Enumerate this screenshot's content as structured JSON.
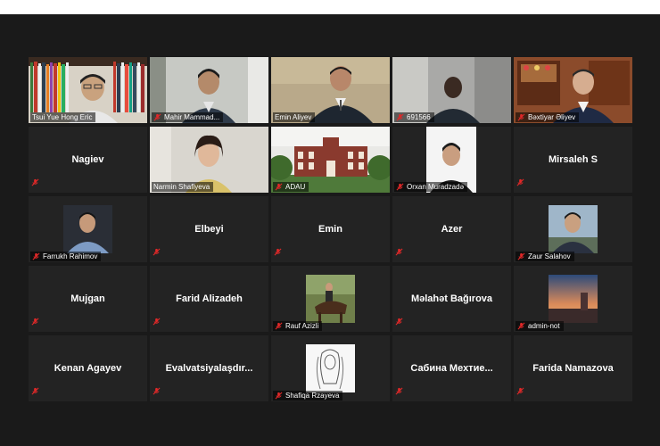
{
  "tiles": [
    {
      "name": "Tsui Yue Hong Eric",
      "kind": "video",
      "muted": false
    },
    {
      "name": "Mahir Mammad...",
      "kind": "video",
      "muted": true
    },
    {
      "name": "Emin Aliyev",
      "kind": "video",
      "muted": false,
      "active": true
    },
    {
      "name": "691566",
      "kind": "video",
      "muted": true
    },
    {
      "name": "Bəxtiyar Əliyev",
      "kind": "video",
      "muted": true
    },
    {
      "name": "Nagiev",
      "kind": "name",
      "muted": true
    },
    {
      "name": "Narmin Shafiyeva",
      "kind": "video",
      "muted": false
    },
    {
      "name": "ADAU",
      "kind": "video",
      "muted": true
    },
    {
      "name": "Orxan Muradzadə",
      "kind": "photo",
      "muted": true
    },
    {
      "name": "Mirsaleh S",
      "kind": "name",
      "muted": true
    },
    {
      "name": "Farrukh Rahimov",
      "kind": "photo",
      "muted": true
    },
    {
      "name": "Elbeyi",
      "kind": "name",
      "muted": true
    },
    {
      "name": "Emin",
      "kind": "name",
      "muted": true
    },
    {
      "name": "Azer",
      "kind": "name",
      "muted": true
    },
    {
      "name": "Zaur Salahov",
      "kind": "photo",
      "muted": true
    },
    {
      "name": "Mujgan",
      "kind": "name",
      "muted": true
    },
    {
      "name": "Farid Alizadeh",
      "kind": "name",
      "muted": true
    },
    {
      "name": "Rauf Azizli",
      "kind": "photo",
      "muted": true
    },
    {
      "name": "Məlahət Bağırova",
      "kind": "name",
      "muted": true
    },
    {
      "name": "admin-not",
      "kind": "photo",
      "muted": true
    },
    {
      "name": "Kenan Agayev",
      "kind": "name",
      "muted": true
    },
    {
      "name": "Evalvatsiyalaşdır...",
      "kind": "name",
      "muted": true
    },
    {
      "name": "Shafiqa Rzayeva",
      "kind": "photo",
      "muted": true
    },
    {
      "name": "Сабина Мехтие...",
      "kind": "name",
      "muted": true
    },
    {
      "name": "Farida Namazova",
      "kind": "name",
      "muted": true
    }
  ],
  "icons": {
    "muted": "mic-muted-icon",
    "unmuted": "mic-icon"
  },
  "colors": {
    "active_border": "#c7d33a",
    "mute_red": "#e02828",
    "tile_bg": "#232323",
    "window_bg": "#1a1a1a"
  }
}
